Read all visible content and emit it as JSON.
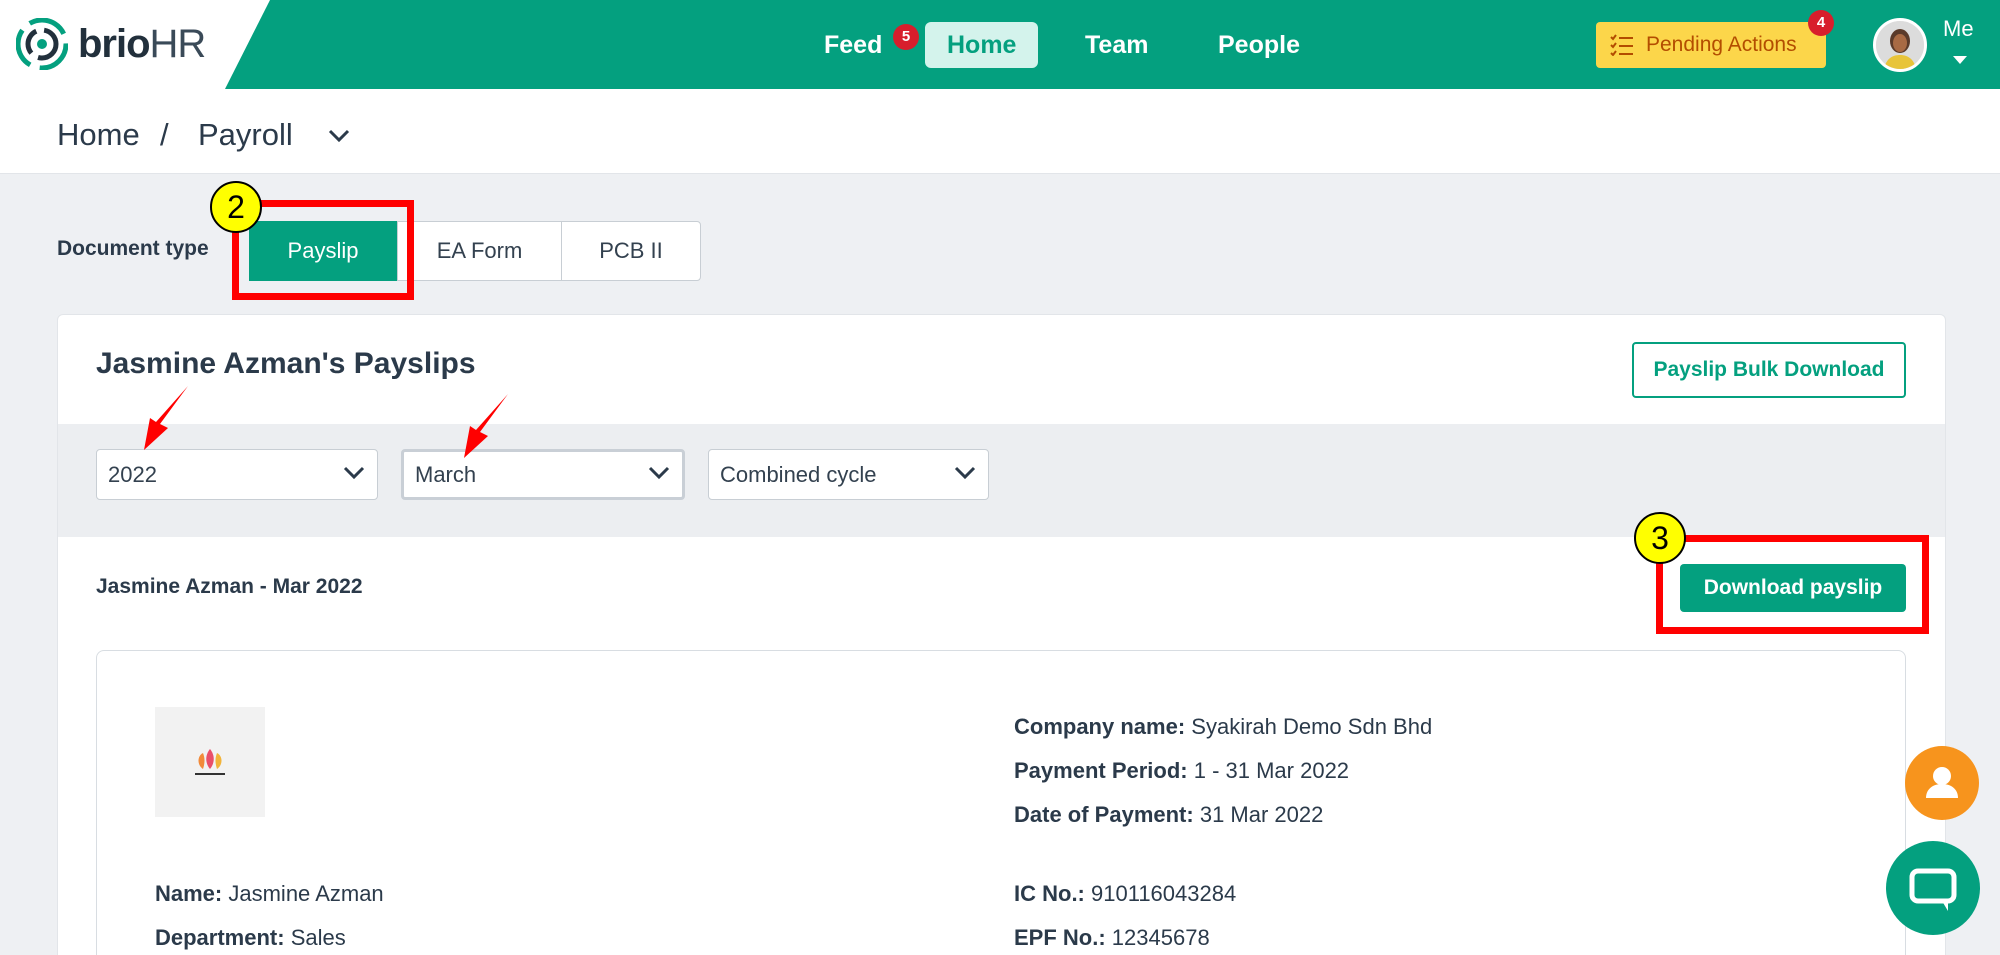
{
  "brand": {
    "name_part1": "brio",
    "name_part2": "HR"
  },
  "nav": {
    "feed": "Feed",
    "feed_badge": "5",
    "home": "Home",
    "team": "Team",
    "people": "People",
    "pending": "Pending Actions",
    "pending_badge": "4",
    "me": "Me"
  },
  "breadcrumb": {
    "home": "Home",
    "sep": "/",
    "current": "Payroll"
  },
  "doctype": {
    "label": "Document type",
    "options": [
      "Payslip",
      "EA Form",
      "PCB II"
    ],
    "selected": "Payslip"
  },
  "card": {
    "title": "Jasmine Azman's Payslips",
    "bulk_button": "Payslip Bulk Download",
    "filters": {
      "year": "2022",
      "month": "March",
      "cycle": "Combined cycle"
    },
    "period_label": "Jasmine Azman - Mar 2022",
    "download_button": "Download payslip"
  },
  "payslip": {
    "company_label": "Company name:",
    "company": "Syakirah Demo Sdn Bhd",
    "period_label": "Payment Period:",
    "period": "1 - 31 Mar 2022",
    "date_label": "Date of Payment:",
    "date": "31 Mar 2022",
    "name_label": "Name:",
    "name": "Jasmine Azman",
    "dept_label": "Department:",
    "dept": "Sales",
    "ic_label": "IC No.:",
    "ic": "910116043284",
    "epf_label": "EPF No.:",
    "epf": "12345678"
  },
  "annotations": {
    "step2": "2",
    "step3": "3"
  },
  "colors": {
    "brand_green": "#04a07f",
    "pending_yellow": "#fcd64a",
    "badge_red": "#d81e2c",
    "annotation_red": "#ff0000"
  }
}
